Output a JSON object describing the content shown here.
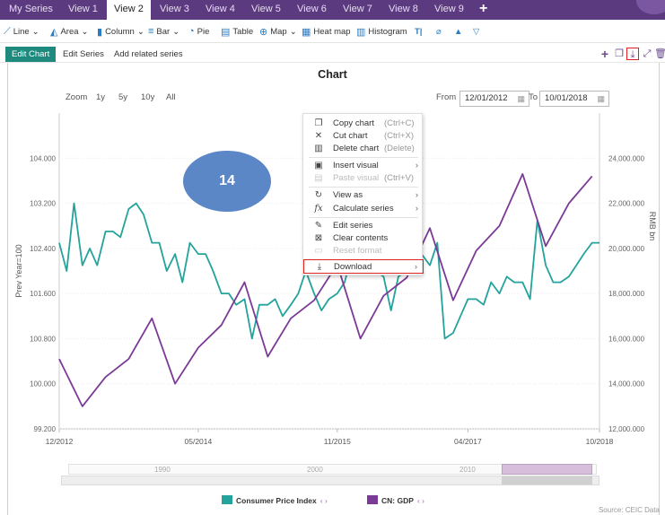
{
  "tabs": [
    "My Series",
    "View 1",
    "View 2",
    "View 3",
    "View 4",
    "View 5",
    "View 6",
    "View 7",
    "View 8",
    "View 9"
  ],
  "add_tab": "+",
  "toolbar": [
    {
      "icon": "line-chart-icon",
      "label": "Line",
      "glyph": "⟋",
      "dd": "⌄"
    },
    {
      "icon": "area-chart-icon",
      "label": "Area",
      "glyph": "◭",
      "dd": "⌄"
    },
    {
      "icon": "column-chart-icon",
      "label": "Column",
      "glyph": "▮",
      "dd": "⌄"
    },
    {
      "icon": "bar-chart-icon",
      "label": "Bar",
      "glyph": "≡",
      "dd": "⌄"
    },
    {
      "icon": "pie-chart-icon",
      "label": "Pie",
      "glyph": "◔",
      "dd": ""
    },
    {
      "icon": "table-icon",
      "label": "Table",
      "glyph": "▤",
      "dd": ""
    },
    {
      "icon": "map-icon",
      "label": "Map",
      "glyph": "⊕",
      "dd": "⌄"
    },
    {
      "icon": "heat-map-icon",
      "label": "Heat map",
      "glyph": "▦",
      "dd": ""
    },
    {
      "icon": "histogram-icon",
      "label": "Histogram",
      "glyph": "▥",
      "dd": ""
    }
  ],
  "subbar": {
    "edit_chart": "Edit Chart",
    "edit_series": "Edit Series",
    "add_related": "Add related series"
  },
  "chart_title": "Chart",
  "zoom": {
    "label": "Zoom",
    "options": [
      "1y",
      "5y",
      "10y",
      "All"
    ]
  },
  "range": {
    "from_label": "From",
    "from": "12/01/2012",
    "to_label": "To",
    "to": "10/01/2018"
  },
  "menu": {
    "copy": {
      "label": "Copy chart",
      "shortcut": "(Ctrl+C)"
    },
    "cut": {
      "label": "Cut chart",
      "shortcut": "(Ctrl+X)"
    },
    "delete": {
      "label": "Delete chart",
      "shortcut": "(Delete)"
    },
    "insert": {
      "label": "Insert visual"
    },
    "paste": {
      "label": "Paste visual",
      "shortcut": "(Ctrl+V)"
    },
    "viewas": {
      "label": "View as"
    },
    "calc": {
      "label": "Calculate series"
    },
    "editseries": {
      "label": "Edit series"
    },
    "clear": {
      "label": "Clear contents"
    },
    "reset": {
      "label": "Reset format"
    },
    "download": {
      "label": "Download"
    }
  },
  "badge": "14",
  "navigator": {
    "labels": [
      "1990",
      "2000",
      "2010"
    ]
  },
  "legend": [
    {
      "name": "Consumer Price Index",
      "color": "#23a39b"
    },
    {
      "name": "CN: GDP",
      "color": "#7b3a96"
    }
  ],
  "source": "Source: CEIC Data",
  "chart_data": {
    "type": "line",
    "x_ticks": [
      "12/2012",
      "05/2014",
      "11/2015",
      "04/2017",
      "10/2018"
    ],
    "y_left": {
      "label": "Prev Year=100",
      "ticks": [
        "104.000",
        "103.200",
        "102.400",
        "101.600",
        "100.800",
        "100.000",
        "99.200"
      ],
      "range": [
        99.2,
        104.8
      ]
    },
    "y_right": {
      "label": "RMB bn",
      "ticks": [
        "24,000.000",
        "22,000.000",
        "20,000.000",
        "18,000.000",
        "16,000.000",
        "14,000.000",
        "12,000.000"
      ],
      "range": [
        12000,
        26000
      ]
    },
    "series": [
      {
        "name": "Consumer Price Index",
        "axis": "left",
        "color": "#23a39b",
        "x": [
          2012.92,
          2013.0,
          2013.08,
          2013.17,
          2013.25,
          2013.33,
          2013.42,
          2013.5,
          2013.58,
          2013.67,
          2013.75,
          2013.83,
          2013.92,
          2014.0,
          2014.08,
          2014.17,
          2014.25,
          2014.33,
          2014.42,
          2014.5,
          2014.58,
          2014.67,
          2014.75,
          2014.83,
          2014.92,
          2015.0,
          2015.08,
          2015.17,
          2015.25,
          2015.33,
          2015.42,
          2015.5,
          2015.58,
          2015.67,
          2015.75,
          2015.83,
          2015.92,
          2016.0,
          2016.08,
          2016.17,
          2016.25,
          2016.33,
          2016.42,
          2016.5,
          2016.58,
          2016.67,
          2016.75,
          2016.83,
          2016.92,
          2017.0,
          2017.08,
          2017.17,
          2017.25,
          2017.33,
          2017.42,
          2017.5,
          2017.58,
          2017.67,
          2017.75,
          2017.83,
          2017.92,
          2018.0,
          2018.08,
          2018.17,
          2018.25,
          2018.33,
          2018.42,
          2018.5,
          2018.58,
          2018.67,
          2018.75
        ],
        "values": [
          102.5,
          102.0,
          103.2,
          102.1,
          102.4,
          102.1,
          102.7,
          102.7,
          102.6,
          103.1,
          103.2,
          103.0,
          102.5,
          102.5,
          102.0,
          102.3,
          101.8,
          102.5,
          102.3,
          102.3,
          102.0,
          101.6,
          101.6,
          101.4,
          101.5,
          100.8,
          101.4,
          101.4,
          101.5,
          101.2,
          101.4,
          101.6,
          102.0,
          101.6,
          101.3,
          101.5,
          101.6,
          101.8,
          102.3,
          102.3,
          102.3,
          102.0,
          101.9,
          101.3,
          101.9,
          102.0,
          102.1,
          102.3,
          102.1,
          102.5,
          100.8,
          100.9,
          101.2,
          101.5,
          101.5,
          101.4,
          101.8,
          101.6,
          101.9,
          101.8,
          101.8,
          101.5,
          102.9,
          102.1,
          101.8,
          101.8,
          101.9,
          102.1,
          102.3,
          102.5,
          102.5
        ]
      },
      {
        "name": "CN: GDP",
        "axis": "right",
        "color": "#7b3a96",
        "x": [
          2012.92,
          2013.17,
          2013.42,
          2013.67,
          2013.92,
          2014.17,
          2014.42,
          2014.67,
          2014.92,
          2015.17,
          2015.42,
          2015.67,
          2015.92,
          2016.17,
          2016.42,
          2016.67,
          2016.92,
          2017.17,
          2017.42,
          2017.67,
          2017.92,
          2018.17,
          2018.42,
          2018.67
        ],
        "values": [
          15100,
          13000,
          14300,
          15100,
          16900,
          14000,
          15600,
          16600,
          18500,
          15200,
          16900,
          17700,
          19300,
          16000,
          17900,
          18700,
          20900,
          17700,
          19900,
          21000,
          23300,
          20100,
          22000,
          23200
        ]
      }
    ]
  }
}
